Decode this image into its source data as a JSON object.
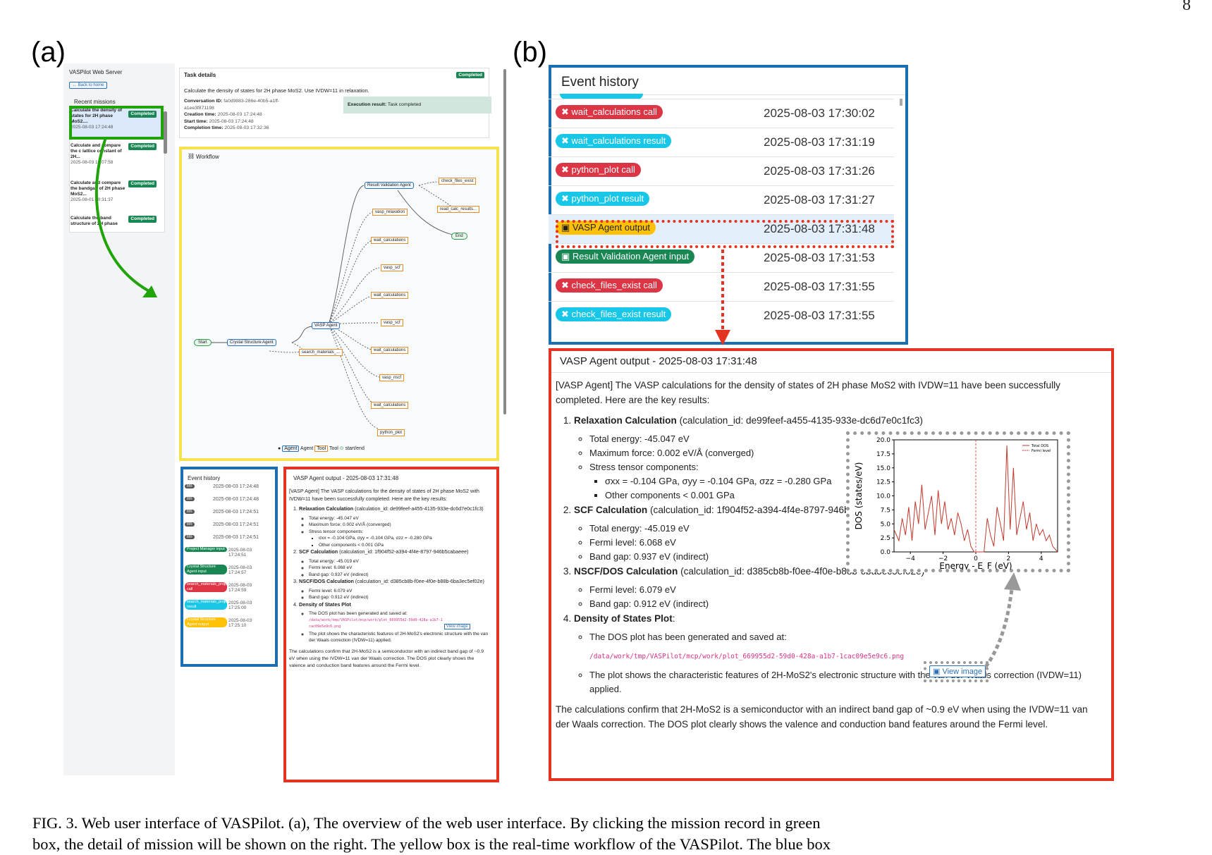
{
  "panel_labels": {
    "a": "(a)",
    "b": "(b)"
  },
  "page_number": "8",
  "left": {
    "app_title": "VASPilot Web Server",
    "back_button": "← Back to home",
    "recent_missions_label": "Recent missions",
    "missions": [
      {
        "title": "Calculate the density of states for 2H phase MoS2....",
        "status": "Completed",
        "time": "2025-08-03 17:24:48"
      },
      {
        "title": "Calculate and compare the c lattice constant of 2H...",
        "status": "Completed",
        "time": "2025-08-03 19:07:58"
      },
      {
        "title": "Calculate and compare the bandgap of 2H phase MoS2...",
        "status": "Completed",
        "time": "2025-08-01 10:31:37"
      },
      {
        "title": "Calculate the band structure of 2H phase",
        "status": "Completed",
        "time": ""
      }
    ],
    "task": {
      "header": "Task details",
      "status": "Completed",
      "description": "Calculate the density of states for 2H phase MoS2. Use IVDW=11 in relaxation.",
      "conversation_label": "Conversation ID:",
      "conversation_id": "fa0d9883-286e-40b5-a1ff-a1ee3f871198",
      "creation_label": "Creation time:",
      "creation_time": "2025-08-03 17:24:48",
      "start_label": "Start time:",
      "start_time": "2025-08-03 17:24:48",
      "completion_label": "Completion time:",
      "completion_time": "2025-08-03 17:32:36",
      "execution_label": "Execution result:",
      "execution_result": "Task completed"
    },
    "workflow": {
      "header": "Workflow",
      "nodes": {
        "start": "Start",
        "crystal": "Crystal Structure Agent",
        "search": "search_materials_...",
        "vasp_agent": "VASP Agent",
        "validation": "Result Validation Agent",
        "check_files": "check_files_exist",
        "read_calc": "read_calc_results...",
        "end": "End",
        "vasp_relaxation": "vasp_relaxation",
        "wait1": "wait_calculations",
        "vasp_scf1": "vasp_scf",
        "wait2": "wait_calculations",
        "vasp_scf2": "vasp_scf",
        "wait3": "wait_calculations",
        "vasp_nscf": "vasp_nscf",
        "wait4": "wait_calculations",
        "python_plot": "python_plot"
      },
      "legend": {
        "agent": "Agent",
        "agent_word": "Agent",
        "tool": "Tool",
        "tool_word": "Tool",
        "startend": "start/end"
      }
    },
    "event_history": {
      "header": "Event history",
      "rows": [
        {
          "tag": "llm",
          "time": "2025-08-03 17:24:48"
        },
        {
          "tag": "llm",
          "time": "2025-08-03 17:24:48"
        },
        {
          "tag": "llm",
          "time": "2025-08-03 17:24:51"
        },
        {
          "tag": "llm",
          "time": "2025-08-03 17:24:51"
        },
        {
          "tag": "llm",
          "time": "2025-08-03 17:24:51"
        },
        {
          "tag": "Project Manager input",
          "time": "2025-08-03 17:24:51"
        },
        {
          "tag": "Crystal Structure Agent input",
          "time": "2025-08-03 17:24:57"
        },
        {
          "tag": "search_materials_project call",
          "time": "2025-08-03 17:24:59"
        },
        {
          "tag": "search_materials_project result",
          "time": "2025-08-03 17:25:00"
        },
        {
          "tag": "Crystal Structure Agent output",
          "time": "2025-08-03 17:25:10"
        }
      ]
    },
    "output": {
      "header": "VASP Agent output - 2025-08-03 17:31:48"
    }
  },
  "right": {
    "event_history": {
      "header": "Event history",
      "rows": [
        {
          "label": "wait_calculations call",
          "time": "2025-08-03 17:30:02",
          "color": "#dc3545"
        },
        {
          "label": "wait_calculations result",
          "time": "2025-08-03 17:31:19",
          "color": "#18c6e8"
        },
        {
          "label": "python_plot call",
          "time": "2025-08-03 17:31:26",
          "color": "#dc3545"
        },
        {
          "label": "python_plot result",
          "time": "2025-08-03 17:31:27",
          "color": "#18c6e8"
        },
        {
          "label": "VASP Agent output",
          "time": "2025-08-03 17:31:48",
          "color": "#ffc107"
        },
        {
          "label": "Result Validation Agent input",
          "time": "2025-08-03 17:31:53",
          "color": "#198754"
        },
        {
          "label": "check_files_exist call",
          "time": "2025-08-03 17:31:55",
          "color": "#dc3545"
        },
        {
          "label": "check_files_exist result",
          "time": "2025-08-03 17:31:55",
          "color": "#18c6e8"
        }
      ]
    },
    "output": {
      "header": "VASP Agent output - 2025-08-03 17:31:48",
      "intro": "[VASP Agent] The VASP calculations for the density of states of 2H phase MoS2 with IVDW=11 have been successfully completed. Here are the key results:",
      "relax_title": "Relaxation Calculation",
      "relax_id": "(calculation_id: de99feef-a455-4135-933e-dc6d7e0c1fc3)",
      "relax_energy": "Total energy: -45.047 eV",
      "relax_force": "Maximum force: 0.002 eV/Å (converged)",
      "relax_stress": "Stress tensor components:",
      "relax_stress_1": "σxx = -0.104 GPa, σyy = -0.104 GPa, σzz = -0.280 GPa",
      "relax_stress_2": "Other components < 0.001 GPa",
      "scf_title": "SCF Calculation",
      "scf_id": "(calculation_id: 1f904f52-a394-4f4e-8797-946b5cabaeee)",
      "scf_energy": "Total energy: -45.019 eV",
      "scf_fermi": "Fermi level: 6.068 eV",
      "scf_gap": "Band gap: 0.937 eV (indirect)",
      "nscf_title": "NSCF/DOS Calculation",
      "nscf_id": "(calculation_id: d385cb8b-f0ee-4f0e-b88b-6ba3ec5ef02e)",
      "nscf_fermi": "Fermi level: 6.079 eV",
      "nscf_gap": "Band gap: 0.912 eV (indirect)",
      "plot_title": "Density of States Plot",
      "plot_saved": "The DOS plot has been generated and saved at:",
      "plot_path": "/data/work/tmp/VASPilot/mcp/work/plot_669955d2-59d0-428a-a1b7-1cac09e5e9c6.png",
      "view_image": "View image",
      "plot_shows": "The plot shows the characteristic features of 2H-MoS2's electronic structure with the van der Waals correction (IVDW=11) applied.",
      "conclusion": "The calculations confirm that 2H-MoS2 is a semiconductor with an indirect band gap of ~0.9 eV when using the IVDW=11 van der Waals correction. The DOS plot clearly shows the valence and conduction band features around the Fermi level."
    }
  },
  "chart_data": {
    "type": "line",
    "xlabel": "Energy - E_F (eV)",
    "ylabel": "DOS (states/eV)",
    "xlim": [
      -5,
      5
    ],
    "ylim": [
      0,
      20
    ],
    "xticks": [
      "−4",
      "−2",
      "0",
      "2",
      "4"
    ],
    "yticks": [
      "0.0",
      "2.5",
      "5.0",
      "7.5",
      "10.0",
      "12.5",
      "15.0",
      "17.5",
      "20.0"
    ],
    "legend": [
      "Total DOS",
      "Fermi level"
    ],
    "series": [
      {
        "name": "Total DOS",
        "x": [
          -5,
          -4.7,
          -4.5,
          -4.3,
          -4.1,
          -3.9,
          -3.7,
          -3.5,
          -3.3,
          -3.1,
          -2.9,
          -2.7,
          -2.5,
          -2.3,
          -2.1,
          -1.9,
          -1.7,
          -1.5,
          -1.3,
          -1.1,
          -0.9,
          -0.7,
          -0.5,
          -0.3,
          -0.1,
          0.1,
          0.3,
          0.5,
          0.7,
          0.9,
          1.1,
          1.3,
          1.5,
          1.7,
          1.9,
          2.1,
          2.3,
          2.5,
          2.7,
          2.9,
          3.1,
          3.3,
          3.5,
          3.7,
          3.9,
          4.1,
          4.3,
          4.5,
          4.7,
          5
        ],
        "y": [
          4,
          2,
          6,
          3,
          8,
          2,
          9,
          5,
          12,
          4,
          7,
          10,
          3,
          11,
          5,
          9,
          4,
          6,
          3,
          7,
          5,
          2,
          4,
          1,
          0,
          0,
          0,
          0,
          6,
          3,
          1,
          8,
          5,
          2,
          19,
          4,
          15,
          3,
          6,
          9,
          4,
          7,
          2,
          5,
          3,
          4,
          2,
          3,
          1,
          0
        ]
      }
    ],
    "fermi_level": 0
  },
  "caption": {
    "line1": "FIG. 3. Web user interface of VASPilot. (a), The overview of the web user interface. By clicking the mission record in green",
    "line2": "box, the detail of mission will be shown on the right. The yellow box is the real-time workflow of the VASPilot. The blue box"
  }
}
